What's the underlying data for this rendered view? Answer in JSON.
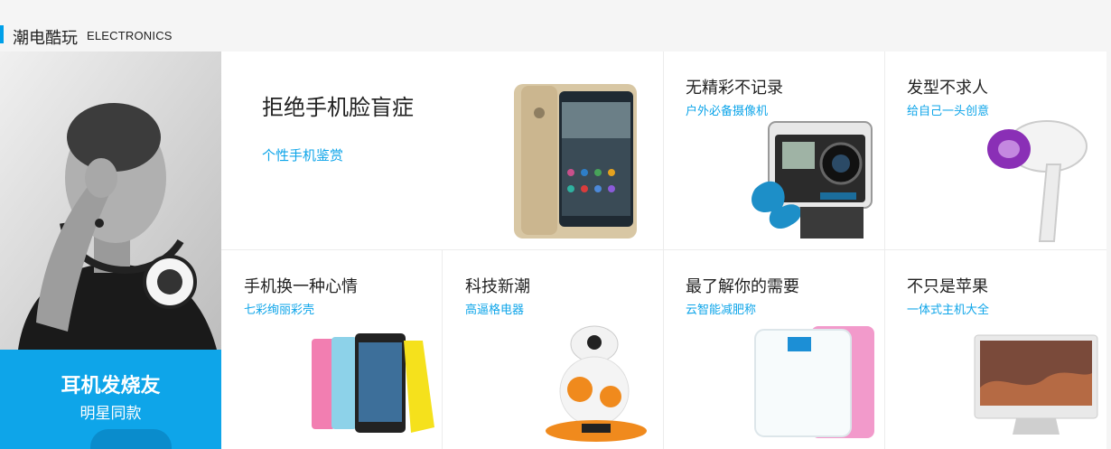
{
  "section": {
    "title": "潮电酷玩",
    "subtitle": "ELECTRONICS",
    "accent_color": "#00a0e9"
  },
  "promo": {
    "title": "耳机发烧友",
    "subtitle": "明星同款",
    "bg_color": "#0ea5e9"
  },
  "tiles": {
    "phone_face": {
      "title": "拒绝手机脸盲症",
      "subtitle": "个性手机鉴赏",
      "icon": "smartphone-gold"
    },
    "camera": {
      "title": "无精彩不记录",
      "subtitle": "户外必备摄像机",
      "icon": "action-camera"
    },
    "hair": {
      "title": "发型不求人",
      "subtitle": "给自己一头创意",
      "icon": "hair-dryer"
    },
    "cases": {
      "title": "手机换一种心情",
      "subtitle": "七彩绚丽彩壳",
      "icon": "colored-phones"
    },
    "tech": {
      "title": "科技新潮",
      "subtitle": "高逼格电器",
      "icon": "bb8-robot"
    },
    "scale": {
      "title": "最了解你的需要",
      "subtitle": "云智能减肥称",
      "icon": "smart-scale"
    },
    "apple": {
      "title": "不只是苹果",
      "subtitle": "一体式主机大全",
      "icon": "all-in-one-pc"
    }
  }
}
